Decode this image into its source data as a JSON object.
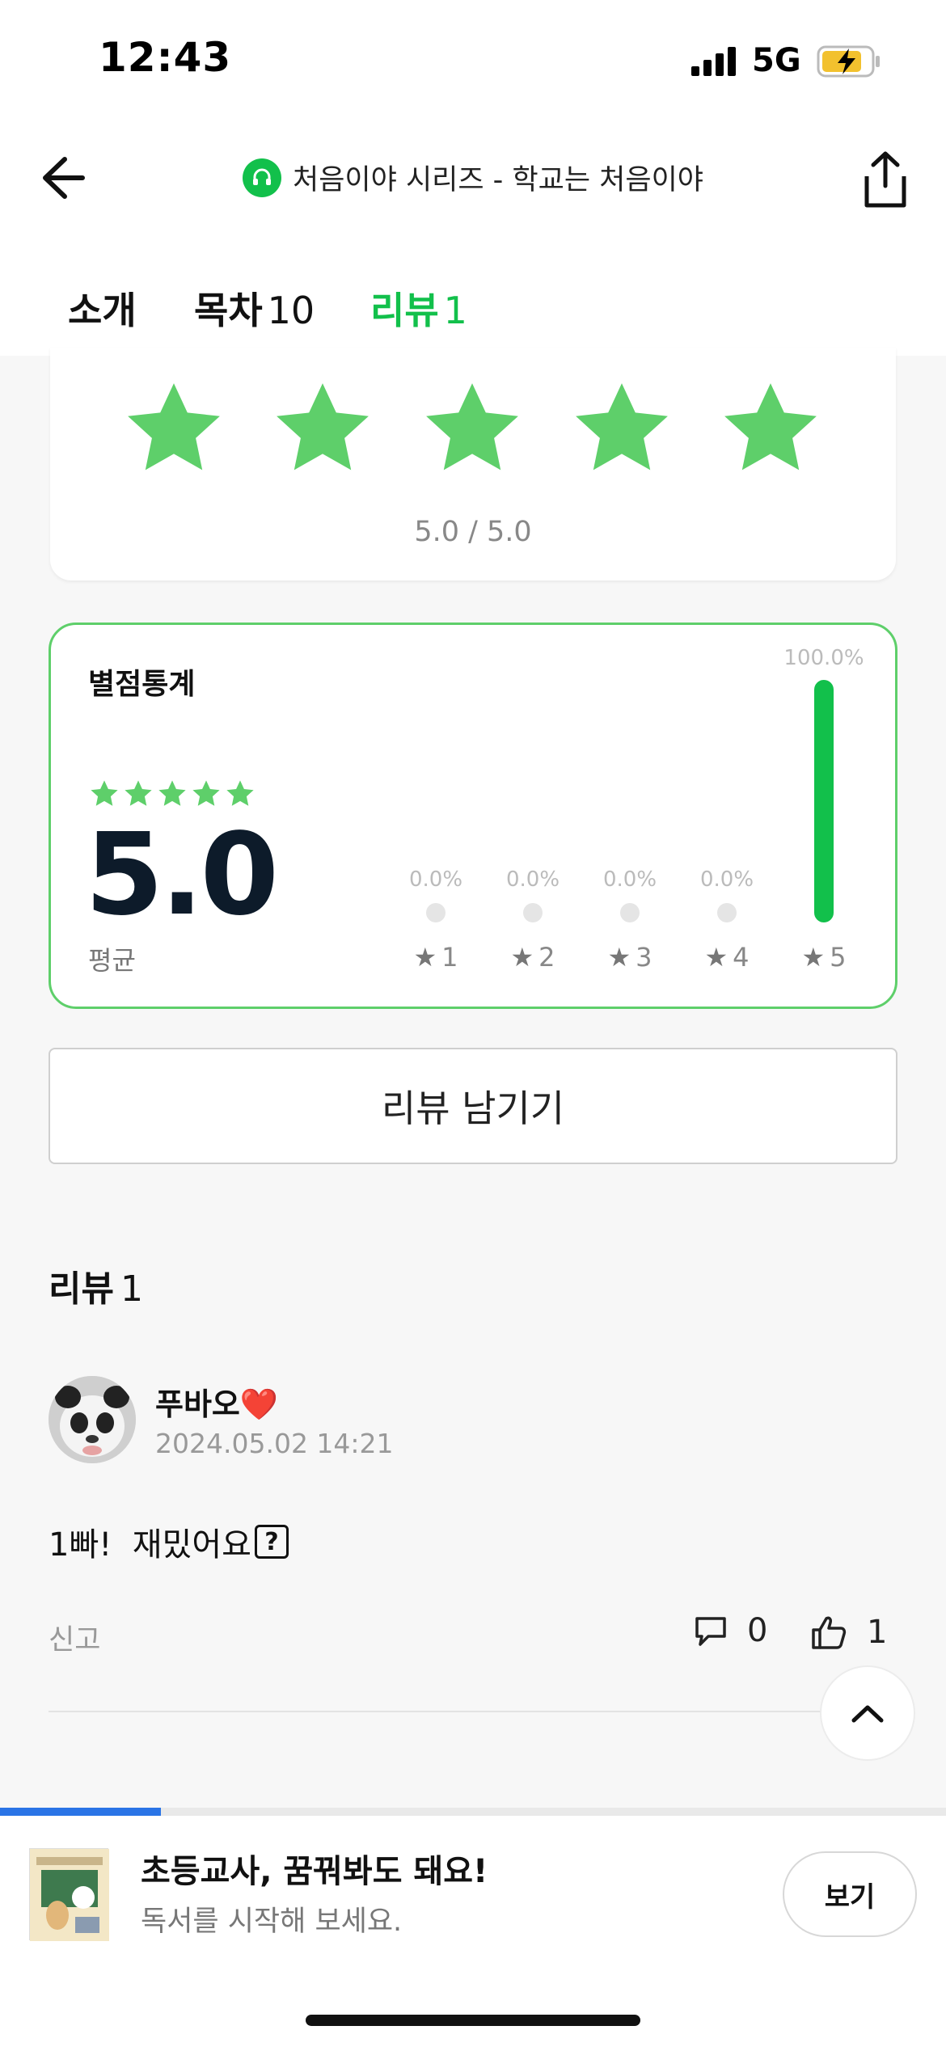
{
  "status_bar": {
    "time": "12:43",
    "network": "5G"
  },
  "header": {
    "title": "처음이야 시리즈 - 학교는 처음이야"
  },
  "tabs": [
    {
      "label": "소개",
      "count": ""
    },
    {
      "label": "목차",
      "count": "10"
    },
    {
      "label": "리뷰",
      "count": "1"
    }
  ],
  "rating_card": {
    "stars": 5,
    "rating_text": "5.0 / 5.0"
  },
  "stats": {
    "title": "별점통계",
    "average": "5.0",
    "average_label": "평균",
    "average_stars": 5,
    "distribution": [
      {
        "star": "1",
        "percent": 0,
        "percent_label": "0.0%"
      },
      {
        "star": "2",
        "percent": 0,
        "percent_label": "0.0%"
      },
      {
        "star": "3",
        "percent": 0,
        "percent_label": "0.0%"
      },
      {
        "star": "4",
        "percent": 0,
        "percent_label": "0.0%"
      },
      {
        "star": "5",
        "percent": 100,
        "percent_label": "100.0%"
      }
    ]
  },
  "leave_review_label": "리뷰 남기기",
  "reviews_section": {
    "heading": "리뷰",
    "count": "1",
    "items": [
      {
        "name": "푸바오❤️",
        "date": "2024.05.02 14:21",
        "text": "1빠!  재밌어요",
        "report_label": "신고",
        "comments": "0",
        "likes": "1"
      }
    ]
  },
  "bottom_bar": {
    "book_title": "초등교사, 꿈꿔봐도 돼요!",
    "book_subtitle": "독서를 시작해 보세요.",
    "view_label": "보기",
    "progress_percent": 17
  },
  "colors": {
    "accent": "#12c04b",
    "star": "#5ecf6a",
    "progress": "#2a74e6"
  }
}
